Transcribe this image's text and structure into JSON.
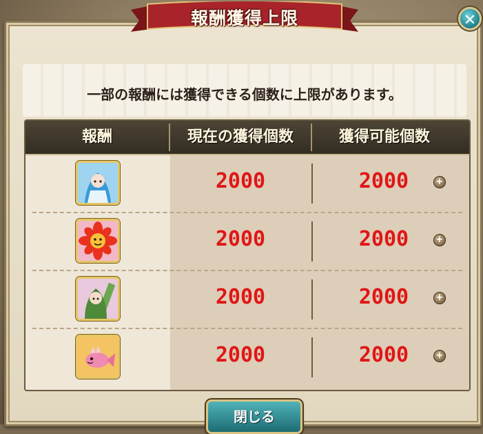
{
  "dialog": {
    "title": "報酬獲得上限",
    "notice": "一部の報酬には獲得できる個数に上限があります。",
    "close_icon_label": "✕",
    "close_button_label": "閉じる"
  },
  "table": {
    "headers": [
      "報酬",
      "現在の獲得個数",
      "獲得可能個数"
    ],
    "rows": [
      {
        "icon": "blue-haired-girl-character-icon",
        "current": "2000",
        "max": "2000"
      },
      {
        "icon": "red-flower-creature-icon",
        "current": "2000",
        "max": "2000"
      },
      {
        "icon": "green-hood-character-icon",
        "current": "2000",
        "max": "2000"
      },
      {
        "icon": "pink-fish-creature-icon",
        "current": "2000",
        "max": "2000"
      }
    ],
    "info_symbol": "+"
  },
  "colors": {
    "value_red": "#e01616",
    "header_bg": "#3c3529",
    "button_teal": "#2a8a90",
    "ribbon_red": "#9e1f22"
  }
}
